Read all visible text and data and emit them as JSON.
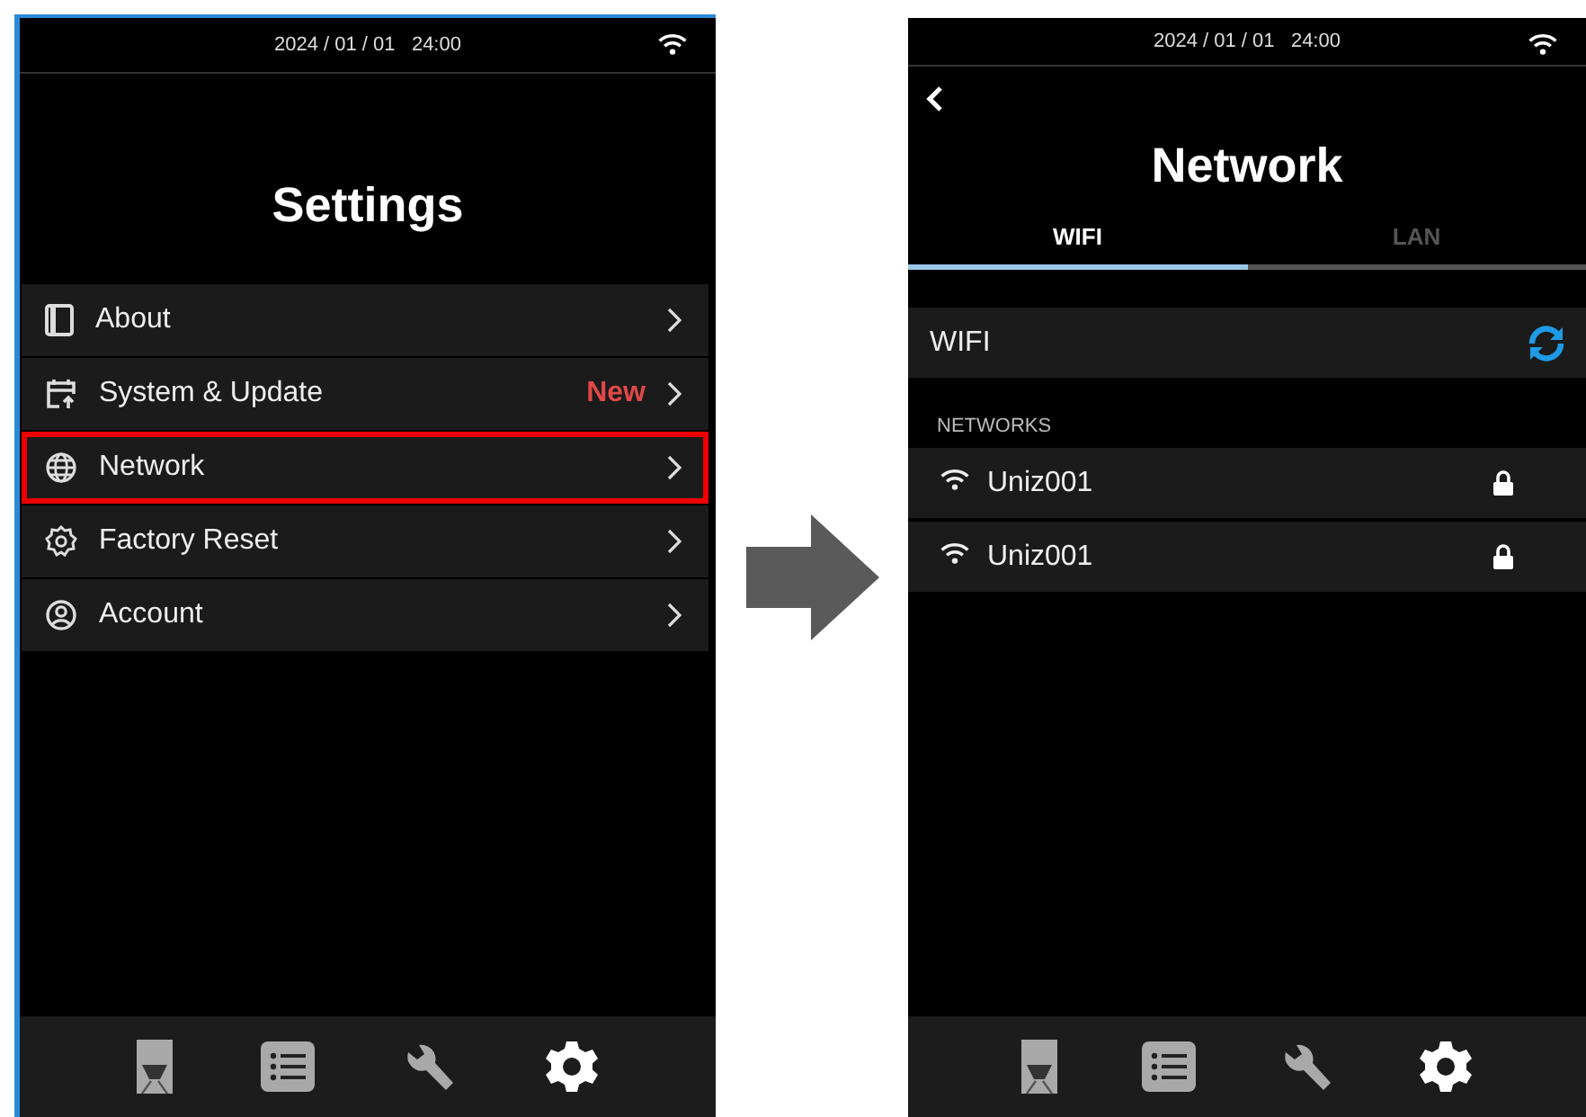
{
  "screens": [
    {
      "kind": "settings",
      "status_bar": {
        "datetime": "2024 / 01 / 01   24:00"
      },
      "title": "Settings",
      "menu": [
        {
          "label": "About",
          "highlighted": false
        },
        {
          "label": "System & Update",
          "badge": "New",
          "highlighted": false
        },
        {
          "label": "Network",
          "highlighted": true
        },
        {
          "label": "Factory Reset",
          "highlighted": false
        },
        {
          "label": "Account",
          "highlighted": false
        }
      ],
      "nav": [
        {
          "selected": false
        },
        {
          "selected": false
        },
        {
          "selected": false
        },
        {
          "selected": true
        }
      ]
    },
    {
      "kind": "network",
      "status_bar": {
        "datetime": "2024 / 01 / 01   24:00"
      },
      "title": "Network",
      "tabs": [
        {
          "label": "WIFI",
          "selected": true
        },
        {
          "label": "LAN",
          "selected": false
        }
      ],
      "wifi_row": {
        "label": "WIFI"
      },
      "section_label": "NETWORKS",
      "networks": [
        {
          "name": "Uniz001",
          "locked": true
        },
        {
          "name": "Uniz001",
          "locked": true
        }
      ],
      "nav": [
        {
          "selected": false
        },
        {
          "selected": false
        },
        {
          "selected": false
        },
        {
          "selected": true
        }
      ]
    }
  ]
}
